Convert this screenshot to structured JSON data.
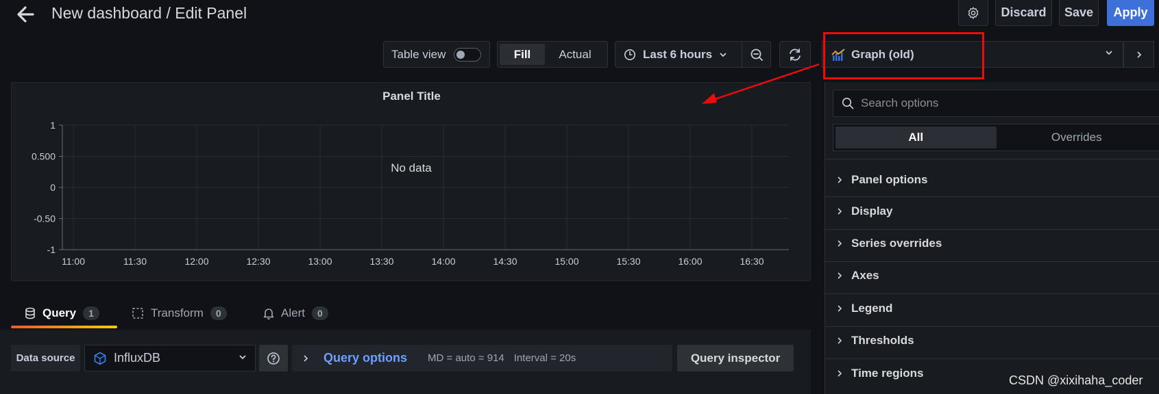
{
  "header": {
    "title": "New dashboard / Edit Panel",
    "discard_label": "Discard",
    "save_label": "Save",
    "apply_label": "Apply"
  },
  "toolbar": {
    "table_view_label": "Table view",
    "table_view_on": false,
    "fill_label": "Fill",
    "actual_label": "Actual",
    "time_range": "Last 6 hours"
  },
  "visualization": {
    "selected": "Graph (old)"
  },
  "panel": {
    "title": "Panel Title",
    "no_data": "No data"
  },
  "chart_data": {
    "type": "line",
    "title": "Panel Title",
    "x_ticks": [
      "11:00",
      "11:30",
      "12:00",
      "12:30",
      "13:00",
      "13:30",
      "14:00",
      "14:30",
      "15:00",
      "15:30",
      "16:00",
      "16:30"
    ],
    "y_ticks": [
      "1",
      "0.500",
      "0",
      "-0.50",
      "-1"
    ],
    "y_values": [
      1,
      0.5,
      0,
      -0.5,
      -1
    ],
    "ylim": [
      -1,
      1
    ],
    "series": [],
    "grid": true,
    "annotation": "No data"
  },
  "query_tabs": [
    {
      "label": "Query",
      "count": "1"
    },
    {
      "label": "Transform",
      "count": "0"
    },
    {
      "label": "Alert",
      "count": "0"
    }
  ],
  "query": {
    "data_source_label": "Data source",
    "data_source": "InfluxDB",
    "options_label": "Query options",
    "md": "MD = auto = 914",
    "interval": "Interval = 20s",
    "inspector_label": "Query inspector"
  },
  "options": {
    "search_placeholder": "Search options",
    "all_label": "All",
    "overrides_label": "Overrides",
    "sections": [
      "Panel options",
      "Display",
      "Series overrides",
      "Axes",
      "Legend",
      "Thresholds",
      "Time regions"
    ]
  },
  "watermark": "CSDN @xixihaha_coder",
  "colors": {
    "background": "#111217",
    "panel": "#181b1f",
    "apply": "#3d71d9",
    "link": "#6e9fff",
    "highlight": "#f00b0b"
  }
}
